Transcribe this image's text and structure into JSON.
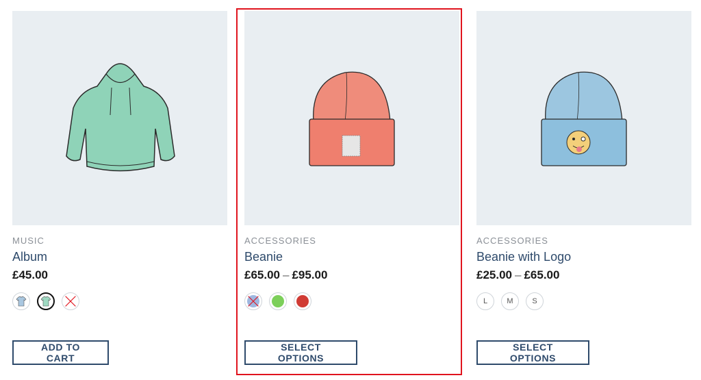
{
  "products": [
    {
      "category": "MUSIC",
      "name": "Album",
      "price": "£45.00",
      "swatch_type": "image",
      "button_label": "ADD TO CART"
    },
    {
      "category": "ACCESSORIES",
      "name": "Beanie",
      "price_from": "£65.00",
      "price_sep": "–",
      "price_to": "£95.00",
      "swatch_colors": [
        "#9fb7e0",
        "#7ccf5a",
        "#d03b34"
      ],
      "button_label": "SELECT OPTIONS"
    },
    {
      "category": "ACCESSORIES",
      "name": "Beanie with Logo",
      "price_from": "£25.00",
      "price_sep": "–",
      "price_to": "£65.00",
      "sizes": [
        "L",
        "M",
        "S"
      ],
      "button_label": "SELECT OPTIONS"
    }
  ],
  "colors": {
    "accent": "#2e4a6b",
    "highlight": "#e0141e",
    "image_bg": "#e9eef2"
  }
}
